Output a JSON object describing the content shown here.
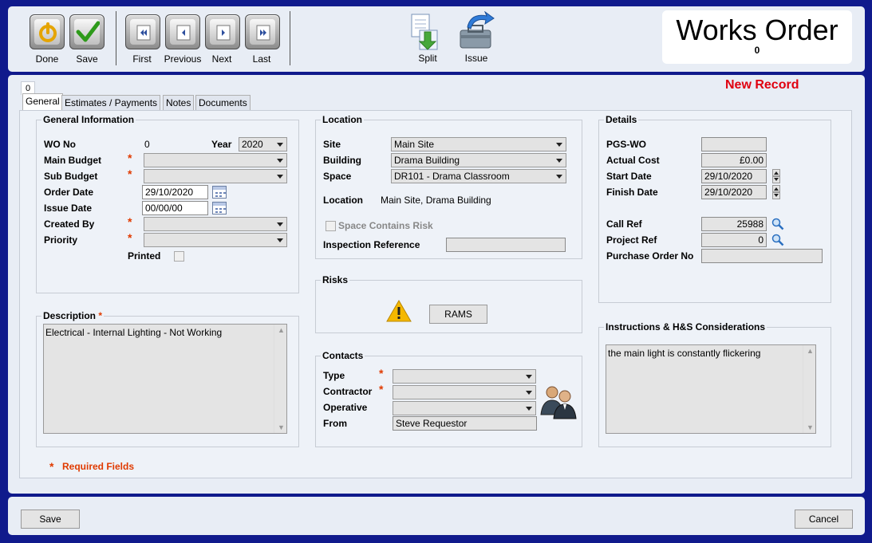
{
  "toolbar": {
    "done": "Done",
    "save": "Save",
    "first": "First",
    "previous": "Previous",
    "next": "Next",
    "last": "Last",
    "split": "Split",
    "issue": "Issue"
  },
  "header": {
    "title": "Works Order",
    "number": "0",
    "record_no": "0",
    "status": "New Record"
  },
  "tabs": [
    "General",
    "Estimates / Payments",
    "Notes",
    "Documents"
  ],
  "general_info": {
    "title": "General Information",
    "wo_no_label": "WO No",
    "wo_no": "0",
    "year_label": "Year",
    "year": "2020",
    "main_budget_label": "Main Budget",
    "main_budget": "",
    "sub_budget_label": "Sub Budget",
    "sub_budget": "",
    "order_date_label": "Order Date",
    "order_date": "29/10/2020",
    "issue_date_label": "Issue Date",
    "issue_date": "00/00/00",
    "created_by_label": "Created By",
    "created_by": "",
    "priority_label": "Priority",
    "priority": "",
    "printed_label": "Printed"
  },
  "description": {
    "title": "Description",
    "text": "Electrical - Internal Lighting - Not Working"
  },
  "required_note": "Required Fields",
  "required_mark": "*",
  "location": {
    "title": "Location",
    "site_label": "Site",
    "site": "Main Site",
    "building_label": "Building",
    "building": "Drama Building",
    "space_label": "Space",
    "space": "DR101 - Drama Classroom",
    "location_label": "Location",
    "location": "Main Site, Drama Building",
    "risk_label": "Space Contains Risk",
    "inspection_label": "Inspection Reference",
    "inspection": ""
  },
  "risks": {
    "title": "Risks",
    "rams": "RAMS"
  },
  "contacts": {
    "title": "Contacts",
    "type_label": "Type",
    "type": "",
    "contractor_label": "Contractor",
    "contractor": "",
    "operative_label": "Operative",
    "operative": "",
    "from_label": "From",
    "from": "Steve Requestor"
  },
  "details": {
    "title": "Details",
    "pgs_wo_label": "PGS-WO",
    "pgs_wo": "",
    "actual_cost_label": "Actual Cost",
    "actual_cost": "£0.00",
    "start_date_label": "Start Date",
    "start_date": "29/10/2020",
    "finish_date_label": "Finish Date",
    "finish_date": "29/10/2020",
    "call_ref_label": "Call Ref",
    "call_ref": "25988",
    "project_ref_label": "Project Ref",
    "project_ref": "0",
    "po_label": "Purchase Order No",
    "po": ""
  },
  "instructions": {
    "title": "Instructions & H&S Considerations",
    "text": "the main light is constantly flickering"
  },
  "footer": {
    "save": "Save",
    "cancel": "Cancel"
  }
}
